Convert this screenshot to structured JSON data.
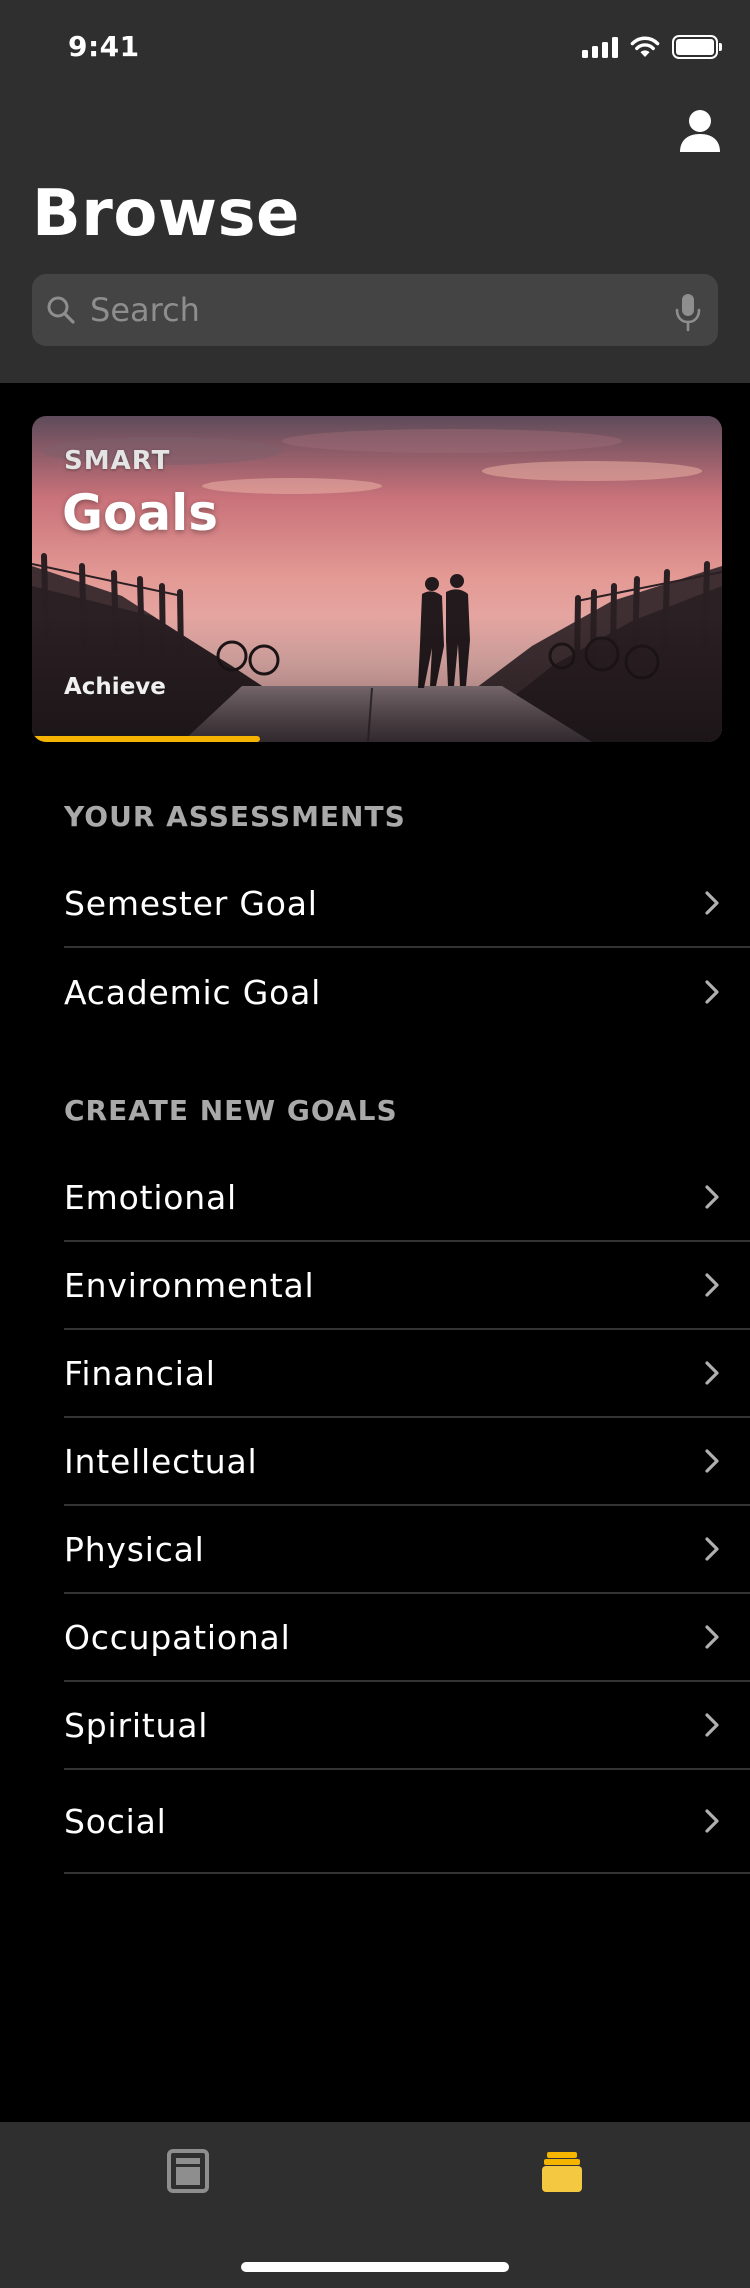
{
  "status_bar": {
    "time": "9:41"
  },
  "header": {
    "title": "Browse",
    "search": {
      "placeholder": "Search",
      "value": ""
    }
  },
  "hero": {
    "eyebrow": "SMART",
    "title": "Goals",
    "subtitle": "Achieve",
    "progress": 0.33
  },
  "assessments": {
    "header": "YOUR ASSESSMENTS",
    "items": [
      {
        "label": "Semester Goal"
      },
      {
        "label": "Academic Goal"
      }
    ]
  },
  "create_goals": {
    "header": "CREATE NEW GOALS",
    "items": [
      {
        "label": "Emotional"
      },
      {
        "label": "Environmental"
      },
      {
        "label": "Financial"
      },
      {
        "label": "Intellectual"
      },
      {
        "label": "Physical"
      },
      {
        "label": "Occupational"
      },
      {
        "label": "Spiritual"
      },
      {
        "label": "Social"
      }
    ]
  },
  "tab_bar": {
    "tabs": [
      {
        "icon": "page-icon",
        "selected": false
      },
      {
        "icon": "stack-icon",
        "selected": true
      }
    ]
  },
  "colors": {
    "accent": "#f5b400",
    "header_bg": "#2f2f2f",
    "background": "#000000",
    "section_header": "#a9a9a9",
    "separator": "#333333"
  }
}
